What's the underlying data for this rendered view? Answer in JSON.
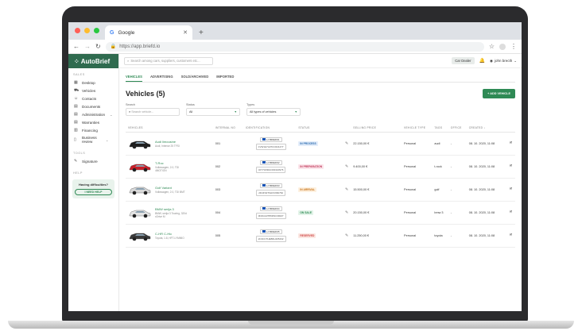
{
  "browser": {
    "tab_title": "Google",
    "url": "https://app.briefd.io"
  },
  "brand": "AutoBrief",
  "sidebar": {
    "section_sales": "SALES",
    "items": [
      "Desktop",
      "Vehicles",
      "Contacts",
      "Documents",
      "Administration",
      "Warranties",
      "Financing",
      "Business review"
    ],
    "section_tools": "TOOLS",
    "tools": [
      "Signature"
    ],
    "section_help": "HELP",
    "help_title": "Having difficulties?",
    "help_button": "I NEED HELP"
  },
  "topbar": {
    "search_placeholder": "Search among cars, suppliers, customers etc...",
    "role": "Car Dealer",
    "user": "john brecth"
  },
  "tabs": [
    "VEHICLES",
    "ADVERTISING",
    "SOLD/ARCHIVED",
    "IMPORTED"
  ],
  "page_title": "Vehicles (5)",
  "add_button": "+ ADD VEHICLE",
  "filters": {
    "search_label": "Search",
    "search_placeholder": "Search vehicle...",
    "status_label": "Status",
    "status_value": "All",
    "types_label": "Types",
    "types_value": "All types of vehicles"
  },
  "columns": [
    "VEHICLES",
    "INTERNAL NO",
    "IDENTIFICATION",
    "STATUS",
    "",
    "SELLING PRICE",
    "VEHICLE TYPE",
    "TAGS",
    "OFFICE",
    "CREATED",
    ""
  ],
  "rows": [
    {
      "name": "Audi limousine",
      "sub": "Audi, Intense 25 TFSI",
      "no": "001",
      "plate": "LJ BRIEFD1",
      "vin": "1VW1H7A37CC621477",
      "status": "IN PROCESS",
      "status_color": "#2b6cb0",
      "status_bg": "#e3edfa",
      "price": "22.150,00 €",
      "type": "Personal",
      "tag": "audi",
      "office": "-",
      "created": "08. 10. 2020, 11:08",
      "car_color": "#1e1e1e"
    },
    {
      "name": "T-Roc",
      "sub": "Volkswagen, 2.0, TDI 4MOTION",
      "no": "002",
      "plate": "LJ BRIEFD2",
      "vin": "4F77G5D101SKG9N76",
      "status": "IN PREPARATION",
      "status_color": "#c0395a",
      "status_bg": "#fbe4ea",
      "price": "9.400,00 €",
      "type": "Personal",
      "tag": "t-rock",
      "office": "-",
      "created": "08. 10. 2020, 11:08",
      "car_color": "#c8202a"
    },
    {
      "name": "Golf Variant",
      "sub": "Volkswagen, 2.0, TDI BMT",
      "no": "003",
      "plate": "LJ BRIEFD3",
      "vin": "2D4FS4T6HVC660762",
      "status": "IN ARRIVAL",
      "status_color": "#c9741a",
      "status_bg": "#fdf0df",
      "price": "15.500,00 €",
      "type": "Personal",
      "tag": "golf",
      "office": "-",
      "created": "08. 10. 2020, 11:08",
      "car_color": "#d8d8d8"
    },
    {
      "name": "BMW serija 3",
      "sub": "BMW, serija 3 Touring, 320d xDrive M",
      "no": "004",
      "plate": "LJ BRIEFD4",
      "vin": "3D4GG3T86DNC39027",
      "status": "ON SALE",
      "status_color": "#2f8a55",
      "status_bg": "#e2f3e8",
      "price": "20.150,00 €",
      "type": "Personal",
      "tag": "bmw 3",
      "office": "-",
      "created": "08. 10. 2020, 11:08",
      "car_color": "#e4e4e4"
    },
    {
      "name": "C-HR C-Hic",
      "sub": "Toyota, 1.8, HFT-LYMMIO",
      "no": "005",
      "plate": "LJ BRIEFD5",
      "vin": "2C3CCTHEBFH165432",
      "status": "RESERVED",
      "status_color": "#d04a4a",
      "status_bg": "#fbe7e2",
      "price": "11.250,00 €",
      "type": "Personal",
      "tag": "toyota",
      "office": "-",
      "created": "08. 10. 2020, 11:08",
      "car_color": "#3a3a3a"
    }
  ]
}
